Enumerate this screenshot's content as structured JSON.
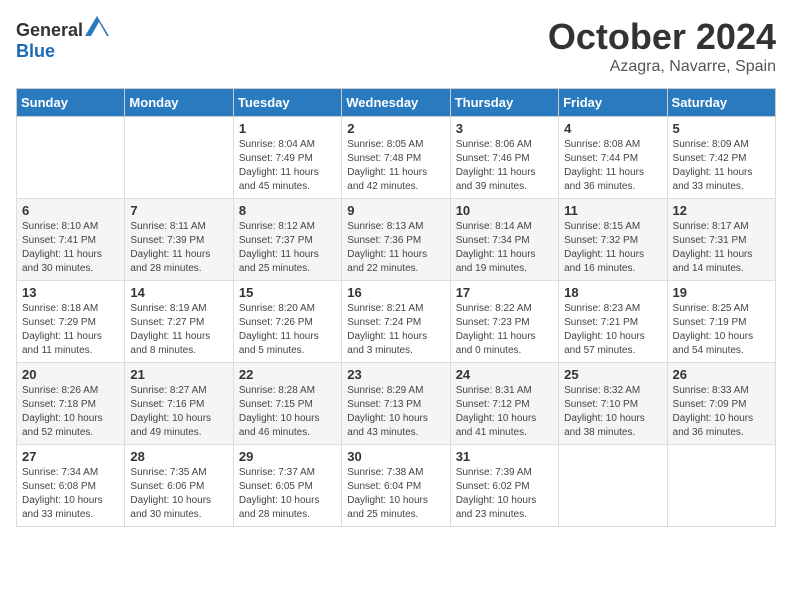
{
  "header": {
    "logo_general": "General",
    "logo_blue": "Blue",
    "month_title": "October 2024",
    "location": "Azagra, Navarre, Spain"
  },
  "weekdays": [
    "Sunday",
    "Monday",
    "Tuesday",
    "Wednesday",
    "Thursday",
    "Friday",
    "Saturday"
  ],
  "weeks": [
    [
      {
        "day": null
      },
      {
        "day": null
      },
      {
        "day": "1",
        "sunrise": "Sunrise: 8:04 AM",
        "sunset": "Sunset: 7:49 PM",
        "daylight": "Daylight: 11 hours and 45 minutes."
      },
      {
        "day": "2",
        "sunrise": "Sunrise: 8:05 AM",
        "sunset": "Sunset: 7:48 PM",
        "daylight": "Daylight: 11 hours and 42 minutes."
      },
      {
        "day": "3",
        "sunrise": "Sunrise: 8:06 AM",
        "sunset": "Sunset: 7:46 PM",
        "daylight": "Daylight: 11 hours and 39 minutes."
      },
      {
        "day": "4",
        "sunrise": "Sunrise: 8:08 AM",
        "sunset": "Sunset: 7:44 PM",
        "daylight": "Daylight: 11 hours and 36 minutes."
      },
      {
        "day": "5",
        "sunrise": "Sunrise: 8:09 AM",
        "sunset": "Sunset: 7:42 PM",
        "daylight": "Daylight: 11 hours and 33 minutes."
      }
    ],
    [
      {
        "day": "6",
        "sunrise": "Sunrise: 8:10 AM",
        "sunset": "Sunset: 7:41 PM",
        "daylight": "Daylight: 11 hours and 30 minutes."
      },
      {
        "day": "7",
        "sunrise": "Sunrise: 8:11 AM",
        "sunset": "Sunset: 7:39 PM",
        "daylight": "Daylight: 11 hours and 28 minutes."
      },
      {
        "day": "8",
        "sunrise": "Sunrise: 8:12 AM",
        "sunset": "Sunset: 7:37 PM",
        "daylight": "Daylight: 11 hours and 25 minutes."
      },
      {
        "day": "9",
        "sunrise": "Sunrise: 8:13 AM",
        "sunset": "Sunset: 7:36 PM",
        "daylight": "Daylight: 11 hours and 22 minutes."
      },
      {
        "day": "10",
        "sunrise": "Sunrise: 8:14 AM",
        "sunset": "Sunset: 7:34 PM",
        "daylight": "Daylight: 11 hours and 19 minutes."
      },
      {
        "day": "11",
        "sunrise": "Sunrise: 8:15 AM",
        "sunset": "Sunset: 7:32 PM",
        "daylight": "Daylight: 11 hours and 16 minutes."
      },
      {
        "day": "12",
        "sunrise": "Sunrise: 8:17 AM",
        "sunset": "Sunset: 7:31 PM",
        "daylight": "Daylight: 11 hours and 14 minutes."
      }
    ],
    [
      {
        "day": "13",
        "sunrise": "Sunrise: 8:18 AM",
        "sunset": "Sunset: 7:29 PM",
        "daylight": "Daylight: 11 hours and 11 minutes."
      },
      {
        "day": "14",
        "sunrise": "Sunrise: 8:19 AM",
        "sunset": "Sunset: 7:27 PM",
        "daylight": "Daylight: 11 hours and 8 minutes."
      },
      {
        "day": "15",
        "sunrise": "Sunrise: 8:20 AM",
        "sunset": "Sunset: 7:26 PM",
        "daylight": "Daylight: 11 hours and 5 minutes."
      },
      {
        "day": "16",
        "sunrise": "Sunrise: 8:21 AM",
        "sunset": "Sunset: 7:24 PM",
        "daylight": "Daylight: 11 hours and 3 minutes."
      },
      {
        "day": "17",
        "sunrise": "Sunrise: 8:22 AM",
        "sunset": "Sunset: 7:23 PM",
        "daylight": "Daylight: 11 hours and 0 minutes."
      },
      {
        "day": "18",
        "sunrise": "Sunrise: 8:23 AM",
        "sunset": "Sunset: 7:21 PM",
        "daylight": "Daylight: 10 hours and 57 minutes."
      },
      {
        "day": "19",
        "sunrise": "Sunrise: 8:25 AM",
        "sunset": "Sunset: 7:19 PM",
        "daylight": "Daylight: 10 hours and 54 minutes."
      }
    ],
    [
      {
        "day": "20",
        "sunrise": "Sunrise: 8:26 AM",
        "sunset": "Sunset: 7:18 PM",
        "daylight": "Daylight: 10 hours and 52 minutes."
      },
      {
        "day": "21",
        "sunrise": "Sunrise: 8:27 AM",
        "sunset": "Sunset: 7:16 PM",
        "daylight": "Daylight: 10 hours and 49 minutes."
      },
      {
        "day": "22",
        "sunrise": "Sunrise: 8:28 AM",
        "sunset": "Sunset: 7:15 PM",
        "daylight": "Daylight: 10 hours and 46 minutes."
      },
      {
        "day": "23",
        "sunrise": "Sunrise: 8:29 AM",
        "sunset": "Sunset: 7:13 PM",
        "daylight": "Daylight: 10 hours and 43 minutes."
      },
      {
        "day": "24",
        "sunrise": "Sunrise: 8:31 AM",
        "sunset": "Sunset: 7:12 PM",
        "daylight": "Daylight: 10 hours and 41 minutes."
      },
      {
        "day": "25",
        "sunrise": "Sunrise: 8:32 AM",
        "sunset": "Sunset: 7:10 PM",
        "daylight": "Daylight: 10 hours and 38 minutes."
      },
      {
        "day": "26",
        "sunrise": "Sunrise: 8:33 AM",
        "sunset": "Sunset: 7:09 PM",
        "daylight": "Daylight: 10 hours and 36 minutes."
      }
    ],
    [
      {
        "day": "27",
        "sunrise": "Sunrise: 7:34 AM",
        "sunset": "Sunset: 6:08 PM",
        "daylight": "Daylight: 10 hours and 33 minutes."
      },
      {
        "day": "28",
        "sunrise": "Sunrise: 7:35 AM",
        "sunset": "Sunset: 6:06 PM",
        "daylight": "Daylight: 10 hours and 30 minutes."
      },
      {
        "day": "29",
        "sunrise": "Sunrise: 7:37 AM",
        "sunset": "Sunset: 6:05 PM",
        "daylight": "Daylight: 10 hours and 28 minutes."
      },
      {
        "day": "30",
        "sunrise": "Sunrise: 7:38 AM",
        "sunset": "Sunset: 6:04 PM",
        "daylight": "Daylight: 10 hours and 25 minutes."
      },
      {
        "day": "31",
        "sunrise": "Sunrise: 7:39 AM",
        "sunset": "Sunset: 6:02 PM",
        "daylight": "Daylight: 10 hours and 23 minutes."
      },
      {
        "day": null
      },
      {
        "day": null
      }
    ]
  ]
}
